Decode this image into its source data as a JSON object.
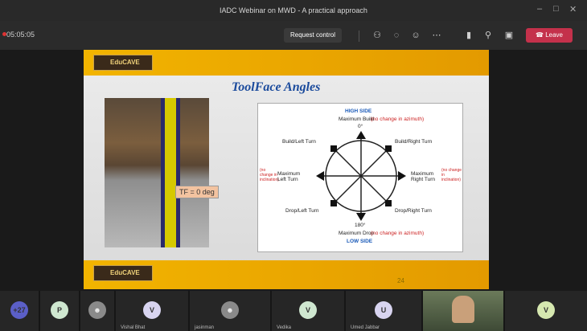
{
  "window": {
    "title": "IADC Webinar on MWD - A practical approach"
  },
  "toolbar": {
    "timer": "05:05:05",
    "request_control": "Request control",
    "leave": "Leave"
  },
  "slide": {
    "logo_text": "EduCAVE",
    "title": "ToolFace Angles",
    "tf_label": "TF = 0 deg",
    "page_number": "24",
    "diagram": {
      "high_side": "HIGH SIDE",
      "max_build": "Maximum Build",
      "max_build_note": "(no change in azimuth)",
      "deg0": "0°",
      "build_left": "Build/Left Turn",
      "build_right": "Build/Right Turn",
      "no_change_incl": "(no change in inclination)",
      "max_left": "Maximum Left Turn",
      "max_right": "Maximum Right Turn",
      "drop_left": "Drop/Left Turn",
      "drop_right": "Drop/Right Turn",
      "deg180": "180°",
      "max_drop": "Maximum Drop",
      "max_drop_note": "(no change in azimuth)",
      "low_side": "LOW SIDE"
    }
  },
  "participants": [
    {
      "initial": "+27",
      "color": "#5b5fc7",
      "name": ""
    },
    {
      "initial": "P",
      "color": "#cfe7d0",
      "name": ""
    },
    {
      "initial": "",
      "color": "#8a8a8a",
      "name": ""
    },
    {
      "initial": "V",
      "color": "#d8d4f0",
      "name": "Vishal Bhat"
    },
    {
      "initial": "",
      "color": "#8a8a8a",
      "name": "jasinman"
    },
    {
      "initial": "V",
      "color": "#cfe7d0",
      "name": "Vedika"
    },
    {
      "initial": "U",
      "color": "#d8d4f0",
      "name": "Umed Jabbar"
    },
    {
      "initial": "V",
      "color": "#d6e8b0",
      "name": ""
    }
  ],
  "icons": [
    "minimize-icon",
    "maximize-icon",
    "close-icon",
    "people-icon",
    "chat-icon",
    "reactions-icon",
    "more-icon",
    "camera-icon",
    "mic-icon",
    "share-icon",
    "phone-icon"
  ]
}
